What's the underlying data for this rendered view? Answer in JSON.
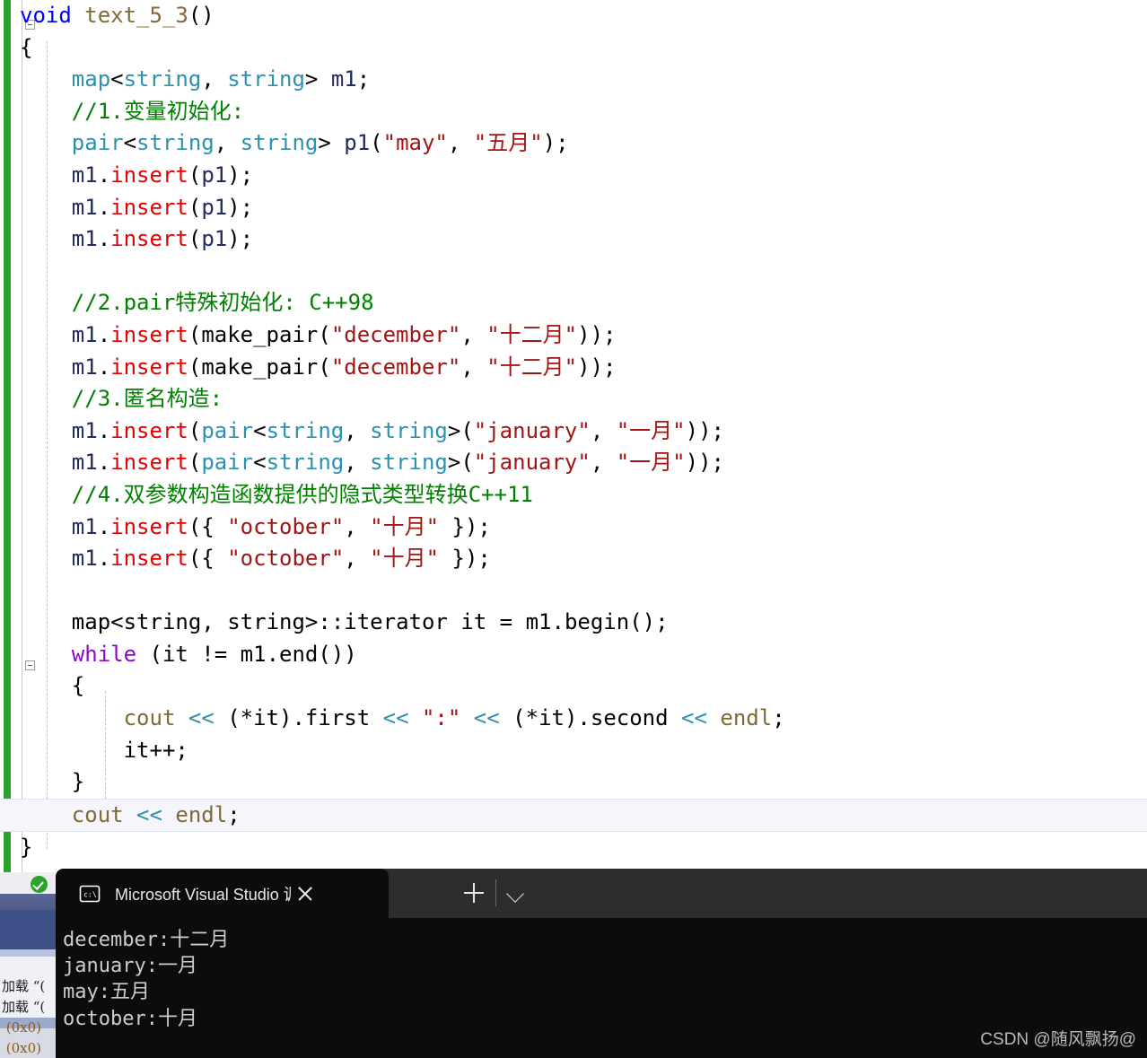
{
  "editor": {
    "name": "visual-studio-code-editor",
    "language": "C++",
    "code_lines": [
      [
        {
          "t": "void",
          "c": "k"
        },
        {
          "t": " ",
          "c": "pl"
        },
        {
          "t": "text_5_3",
          "c": "fn"
        },
        {
          "t": "()",
          "c": "op"
        }
      ],
      [
        {
          "t": "{",
          "c": "op"
        }
      ],
      [
        {
          "t": "    ",
          "c": "pl"
        },
        {
          "t": "map",
          "c": "ty"
        },
        {
          "t": "<",
          "c": "op"
        },
        {
          "t": "string",
          "c": "ty"
        },
        {
          "t": ", ",
          "c": "op"
        },
        {
          "t": "string",
          "c": "ty"
        },
        {
          "t": "> ",
          "c": "op"
        },
        {
          "t": "m1",
          "c": "var"
        },
        {
          "t": ";",
          "c": "op"
        }
      ],
      [
        {
          "t": "    ",
          "c": "pl"
        },
        {
          "t": "//1.变量初始化:",
          "c": "cm"
        }
      ],
      [
        {
          "t": "    ",
          "c": "pl"
        },
        {
          "t": "pair",
          "c": "ty"
        },
        {
          "t": "<",
          "c": "op"
        },
        {
          "t": "string",
          "c": "ty"
        },
        {
          "t": ", ",
          "c": "op"
        },
        {
          "t": "string",
          "c": "ty"
        },
        {
          "t": "> ",
          "c": "op"
        },
        {
          "t": "p1",
          "c": "var"
        },
        {
          "t": "(",
          "c": "op"
        },
        {
          "t": "\"may\"",
          "c": "str"
        },
        {
          "t": ", ",
          "c": "op"
        },
        {
          "t": "\"五月\"",
          "c": "str"
        },
        {
          "t": ");",
          "c": "op"
        }
      ],
      [
        {
          "t": "    ",
          "c": "pl"
        },
        {
          "t": "m1",
          "c": "var"
        },
        {
          "t": ".",
          "c": "op"
        },
        {
          "t": "insert",
          "c": "mth"
        },
        {
          "t": "(",
          "c": "op"
        },
        {
          "t": "p1",
          "c": "var"
        },
        {
          "t": ");",
          "c": "op"
        }
      ],
      [
        {
          "t": "    ",
          "c": "pl"
        },
        {
          "t": "m1",
          "c": "var"
        },
        {
          "t": ".",
          "c": "op"
        },
        {
          "t": "insert",
          "c": "mth"
        },
        {
          "t": "(",
          "c": "op"
        },
        {
          "t": "p1",
          "c": "var"
        },
        {
          "t": ");",
          "c": "op"
        }
      ],
      [
        {
          "t": "    ",
          "c": "pl"
        },
        {
          "t": "m1",
          "c": "var"
        },
        {
          "t": ".",
          "c": "op"
        },
        {
          "t": "insert",
          "c": "mth"
        },
        {
          "t": "(",
          "c": "op"
        },
        {
          "t": "p1",
          "c": "var"
        },
        {
          "t": ");",
          "c": "op"
        }
      ],
      [],
      [
        {
          "t": "    ",
          "c": "pl"
        },
        {
          "t": "//2.pair特殊初始化: C++98",
          "c": "cm"
        }
      ],
      [
        {
          "t": "    ",
          "c": "pl"
        },
        {
          "t": "m1",
          "c": "var"
        },
        {
          "t": ".",
          "c": "op"
        },
        {
          "t": "insert",
          "c": "mth"
        },
        {
          "t": "(",
          "c": "op"
        },
        {
          "t": "make_pair",
          "c": "pl"
        },
        {
          "t": "(",
          "c": "op"
        },
        {
          "t": "\"december\"",
          "c": "str"
        },
        {
          "t": ", ",
          "c": "op"
        },
        {
          "t": "\"十二月\"",
          "c": "str"
        },
        {
          "t": "));",
          "c": "op"
        }
      ],
      [
        {
          "t": "    ",
          "c": "pl"
        },
        {
          "t": "m1",
          "c": "var"
        },
        {
          "t": ".",
          "c": "op"
        },
        {
          "t": "insert",
          "c": "mth"
        },
        {
          "t": "(",
          "c": "op"
        },
        {
          "t": "make_pair",
          "c": "pl"
        },
        {
          "t": "(",
          "c": "op"
        },
        {
          "t": "\"december\"",
          "c": "str"
        },
        {
          "t": ", ",
          "c": "op"
        },
        {
          "t": "\"十二月\"",
          "c": "str"
        },
        {
          "t": "));",
          "c": "op"
        }
      ],
      [
        {
          "t": "    ",
          "c": "pl"
        },
        {
          "t": "//3.匿名构造:",
          "c": "cm"
        }
      ],
      [
        {
          "t": "    ",
          "c": "pl"
        },
        {
          "t": "m1",
          "c": "var"
        },
        {
          "t": ".",
          "c": "op"
        },
        {
          "t": "insert",
          "c": "mth"
        },
        {
          "t": "(",
          "c": "op"
        },
        {
          "t": "pair",
          "c": "ty"
        },
        {
          "t": "<",
          "c": "op"
        },
        {
          "t": "string",
          "c": "ty"
        },
        {
          "t": ", ",
          "c": "op"
        },
        {
          "t": "string",
          "c": "ty"
        },
        {
          "t": ">(",
          "c": "op"
        },
        {
          "t": "\"january\"",
          "c": "str"
        },
        {
          "t": ", ",
          "c": "op"
        },
        {
          "t": "\"一月\"",
          "c": "str"
        },
        {
          "t": "));",
          "c": "op"
        }
      ],
      [
        {
          "t": "    ",
          "c": "pl"
        },
        {
          "t": "m1",
          "c": "var"
        },
        {
          "t": ".",
          "c": "op"
        },
        {
          "t": "insert",
          "c": "mth"
        },
        {
          "t": "(",
          "c": "op"
        },
        {
          "t": "pair",
          "c": "ty"
        },
        {
          "t": "<",
          "c": "op"
        },
        {
          "t": "string",
          "c": "ty"
        },
        {
          "t": ", ",
          "c": "op"
        },
        {
          "t": "string",
          "c": "ty"
        },
        {
          "t": ">(",
          "c": "op"
        },
        {
          "t": "\"january\"",
          "c": "str"
        },
        {
          "t": ", ",
          "c": "op"
        },
        {
          "t": "\"一月\"",
          "c": "str"
        },
        {
          "t": "));",
          "c": "op"
        }
      ],
      [
        {
          "t": "    ",
          "c": "pl"
        },
        {
          "t": "//4.双参数构造函数提供的隐式类型转换C++11",
          "c": "cm"
        }
      ],
      [
        {
          "t": "    ",
          "c": "pl"
        },
        {
          "t": "m1",
          "c": "var"
        },
        {
          "t": ".",
          "c": "op"
        },
        {
          "t": "insert",
          "c": "mth"
        },
        {
          "t": "({ ",
          "c": "op"
        },
        {
          "t": "\"october\"",
          "c": "str"
        },
        {
          "t": ", ",
          "c": "op"
        },
        {
          "t": "\"十月\"",
          "c": "str"
        },
        {
          "t": " });",
          "c": "op"
        }
      ],
      [
        {
          "t": "    ",
          "c": "pl"
        },
        {
          "t": "m1",
          "c": "var"
        },
        {
          "t": ".",
          "c": "op"
        },
        {
          "t": "insert",
          "c": "mth"
        },
        {
          "t": "({ ",
          "c": "op"
        },
        {
          "t": "\"october\"",
          "c": "str"
        },
        {
          "t": ", ",
          "c": "op"
        },
        {
          "t": "\"十月\"",
          "c": "str"
        },
        {
          "t": " });",
          "c": "op"
        }
      ],
      [],
      [
        {
          "t": "    ",
          "c": "pl"
        },
        {
          "t": "map",
          "c": "pl"
        },
        {
          "t": "<",
          "c": "op"
        },
        {
          "t": "string",
          "c": "pl"
        },
        {
          "t": ", ",
          "c": "op"
        },
        {
          "t": "string",
          "c": "pl"
        },
        {
          "t": ">::",
          "c": "op"
        },
        {
          "t": "iterator",
          "c": "pl"
        },
        {
          "t": " ",
          "c": "pl"
        },
        {
          "t": "it",
          "c": "pl"
        },
        {
          "t": " = ",
          "c": "op"
        },
        {
          "t": "m1",
          "c": "pl"
        },
        {
          "t": ".",
          "c": "op"
        },
        {
          "t": "begin",
          "c": "pl"
        },
        {
          "t": "();",
          "c": "op"
        }
      ],
      [
        {
          "t": "    ",
          "c": "pl"
        },
        {
          "t": "while",
          "c": "kc"
        },
        {
          "t": " (",
          "c": "op"
        },
        {
          "t": "it",
          "c": "pl"
        },
        {
          "t": " != ",
          "c": "op"
        },
        {
          "t": "m1",
          "c": "pl"
        },
        {
          "t": ".",
          "c": "op"
        },
        {
          "t": "end",
          "c": "pl"
        },
        {
          "t": "())",
          "c": "op"
        }
      ],
      [
        {
          "t": "    ",
          "c": "pl"
        },
        {
          "t": "{",
          "c": "op"
        }
      ],
      [
        {
          "t": "        ",
          "c": "pl"
        },
        {
          "t": "cout",
          "c": "gl"
        },
        {
          "t": " ",
          "c": "pl"
        },
        {
          "t": "<<",
          "c": "sh"
        },
        {
          "t": " (*",
          "c": "op"
        },
        {
          "t": "it",
          "c": "pl"
        },
        {
          "t": ").",
          "c": "op"
        },
        {
          "t": "first",
          "c": "pl"
        },
        {
          "t": " ",
          "c": "pl"
        },
        {
          "t": "<<",
          "c": "sh"
        },
        {
          "t": " ",
          "c": "pl"
        },
        {
          "t": "\":\"",
          "c": "str"
        },
        {
          "t": " ",
          "c": "pl"
        },
        {
          "t": "<<",
          "c": "sh"
        },
        {
          "t": " (*",
          "c": "op"
        },
        {
          "t": "it",
          "c": "pl"
        },
        {
          "t": ").",
          "c": "op"
        },
        {
          "t": "second",
          "c": "pl"
        },
        {
          "t": " ",
          "c": "pl"
        },
        {
          "t": "<<",
          "c": "sh"
        },
        {
          "t": " ",
          "c": "pl"
        },
        {
          "t": "endl",
          "c": "gl"
        },
        {
          "t": ";",
          "c": "op"
        }
      ],
      [
        {
          "t": "        ",
          "c": "pl"
        },
        {
          "t": "it",
          "c": "pl"
        },
        {
          "t": "++;",
          "c": "op"
        }
      ],
      [
        {
          "t": "    ",
          "c": "pl"
        },
        {
          "t": "}",
          "c": "op"
        }
      ],
      [
        {
          "t": "    ",
          "c": "pl"
        },
        {
          "t": "cout",
          "c": "gl"
        },
        {
          "t": " ",
          "c": "pl"
        },
        {
          "t": "<<",
          "c": "sh"
        },
        {
          "t": " ",
          "c": "pl"
        },
        {
          "t": "endl",
          "c": "gl"
        },
        {
          "t": ";",
          "c": "op"
        }
      ],
      [
        {
          "t": "}",
          "c": "op"
        }
      ]
    ],
    "highlighted_line_index": 25
  },
  "output_panel": {
    "name": "visual-studio-output-window",
    "lines": [
      "加载 “(",
      "加载 “(",
      " (0x0)",
      " (0x0)"
    ],
    "build_status_icon": "success-check-icon"
  },
  "terminal": {
    "tab": {
      "icon": "console-prompt-icon",
      "title": "Microsoft Visual Studio 调试控",
      "close_label": "×"
    },
    "new_tab_label": "+",
    "dropdown_label": "⌄",
    "output": "december:十二月\njanuary:一月\nmay:五月\noctober:十月"
  },
  "watermark": {
    "text": "CSDN @随风飘扬@"
  },
  "colors": {
    "keyword": "#0000FF",
    "control_keyword": "#8F08C4",
    "type": "#2B91AF",
    "function": "#7D6A36",
    "method": "#E40000",
    "string": "#A31515",
    "comment": "#008000",
    "terminal_bg": "#0C0C0C",
    "terminal_titlebar": "#2D2D2D",
    "change_bar": "#2EA22E"
  }
}
